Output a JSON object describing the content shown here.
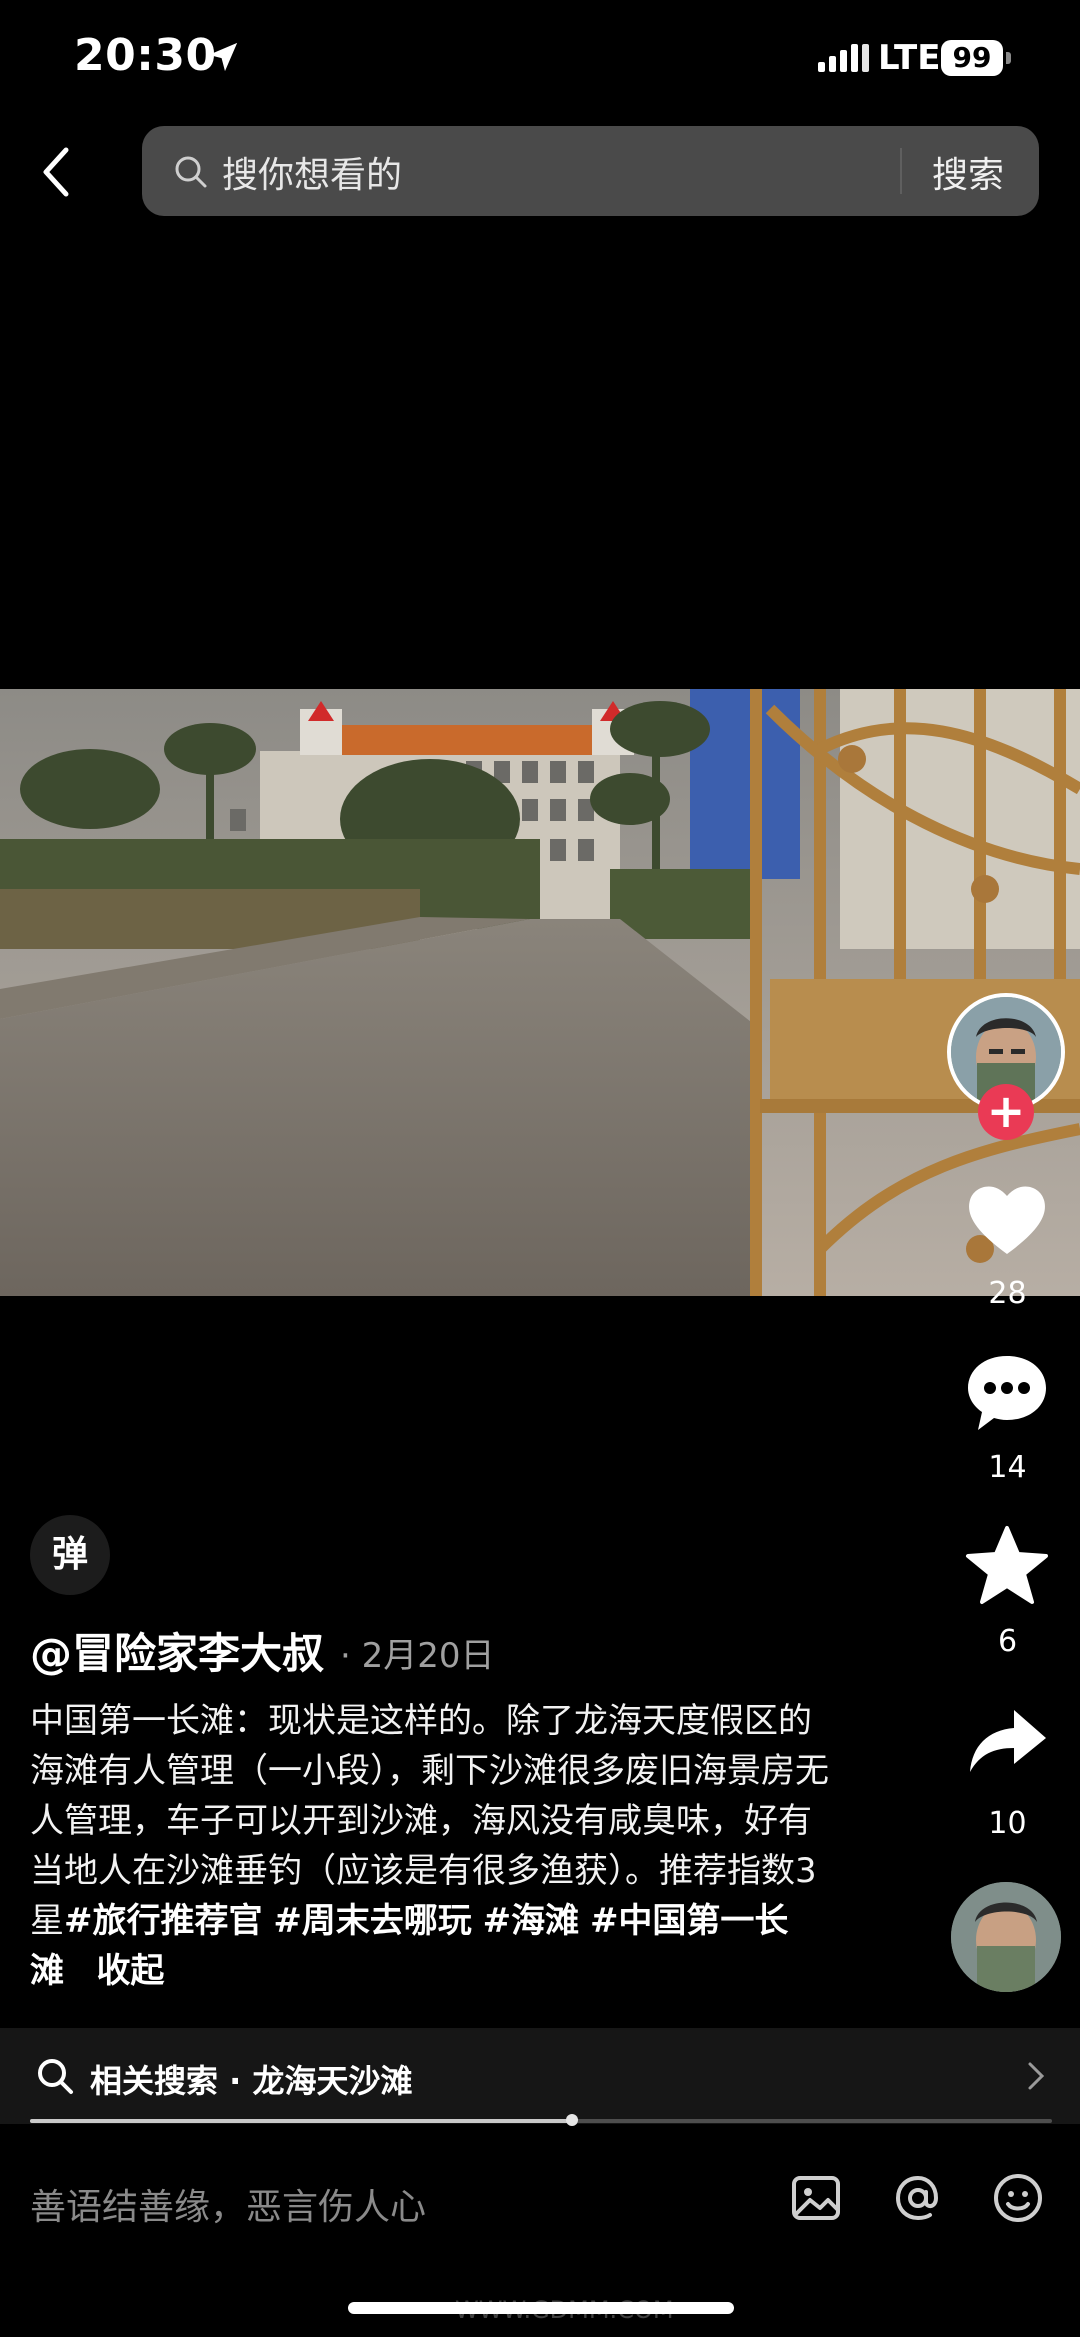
{
  "status_bar": {
    "time": "20:30",
    "network": "LTE",
    "battery": "99"
  },
  "header": {
    "search_placeholder": "搜你想看的",
    "search_button": "搜索"
  },
  "sidebar": {
    "likes": "28",
    "comments": "14",
    "favorites": "6",
    "shares": "10"
  },
  "danmu": {
    "label": "弹"
  },
  "post": {
    "author": "@冒险家李大叔",
    "date": "· 2月20日",
    "caption_text": "中国第一长滩：现状是这样的。除了龙海天度假区的海滩有人管理（一小段），剩下沙滩很多废旧海景房无人管理，车子可以开到沙滩，海风没有咸臭味，好有当地人在沙滩垂钓（应该是有很多渔获）。推荐指数3星",
    "tags": [
      "#旅行推荐官",
      "#周末去哪玩",
      "#海滩",
      "#中国第一长滩"
    ],
    "collapse_label": "收起"
  },
  "related_search": {
    "label": "相关搜索 · 龙海天沙滩"
  },
  "playback": {
    "progress": 0.53
  },
  "comment_bar": {
    "placeholder": "善语结善缘，恶言伤人心"
  },
  "watermark": "WWW.GDMM.COM",
  "colors": {
    "follow": "#ea3a55",
    "search_bg": "#4a4a4a",
    "bar_bg": "#161616"
  }
}
